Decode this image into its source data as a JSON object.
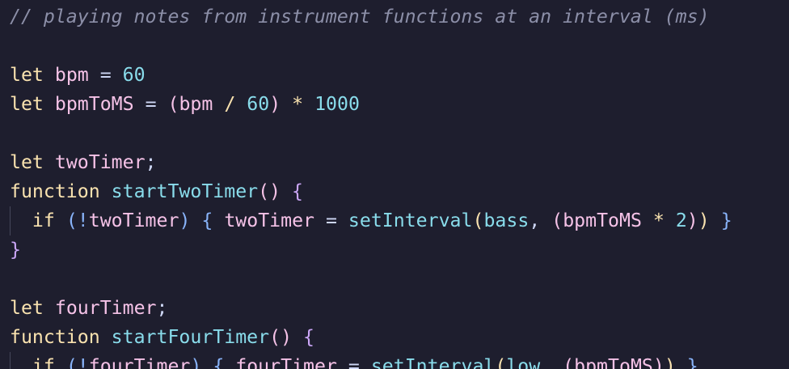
{
  "colors": {
    "background": "#1e1e2e",
    "comment": "#8c8fa8",
    "keyword": "#cba6f7",
    "let": "#f9e2af",
    "variable": "#f5c2e7",
    "plain": "#cdd6f4",
    "number": "#89dceb",
    "operator": "#89dceb",
    "function": "#89dceb",
    "paren_pink": "#f5c2e7",
    "paren_yellow": "#f9e2af",
    "paren_blue": "#89b4fa",
    "brace_pink": "#f5c2e7",
    "brace_blue": "#89b4fa",
    "brace_purple": "#cba6f7",
    "punct": "#cdd6f4",
    "indent_guide": "#45475a"
  },
  "lines": [
    {
      "indent": false,
      "tokens": [
        {
          "t": "// playing notes from instrument functions at an interval (ms)",
          "c": "comment",
          "i": true
        }
      ]
    },
    {
      "indent": false,
      "tokens": []
    },
    {
      "indent": false,
      "tokens": [
        {
          "t": "let",
          "c": "let"
        },
        {
          "t": " ",
          "c": "plain"
        },
        {
          "t": "bpm",
          "c": "variable"
        },
        {
          "t": " ",
          "c": "plain"
        },
        {
          "t": "=",
          "c": "plain"
        },
        {
          "t": " ",
          "c": "plain"
        },
        {
          "t": "60",
          "c": "number"
        }
      ]
    },
    {
      "indent": false,
      "tokens": [
        {
          "t": "let",
          "c": "let"
        },
        {
          "t": " ",
          "c": "plain"
        },
        {
          "t": "bpmToMS",
          "c": "variable"
        },
        {
          "t": " ",
          "c": "plain"
        },
        {
          "t": "=",
          "c": "plain"
        },
        {
          "t": " ",
          "c": "plain"
        },
        {
          "t": "(",
          "c": "paren_pink"
        },
        {
          "t": "bpm",
          "c": "variable"
        },
        {
          "t": " ",
          "c": "plain"
        },
        {
          "t": "/",
          "c": "let"
        },
        {
          "t": " ",
          "c": "plain"
        },
        {
          "t": "60",
          "c": "number"
        },
        {
          "t": ")",
          "c": "paren_pink"
        },
        {
          "t": " ",
          "c": "plain"
        },
        {
          "t": "*",
          "c": "let"
        },
        {
          "t": " ",
          "c": "plain"
        },
        {
          "t": "1000",
          "c": "number"
        }
      ]
    },
    {
      "indent": false,
      "tokens": []
    },
    {
      "indent": false,
      "tokens": [
        {
          "t": "let",
          "c": "let"
        },
        {
          "t": " ",
          "c": "plain"
        },
        {
          "t": "twoTimer",
          "c": "variable"
        },
        {
          "t": ";",
          "c": "punct"
        }
      ]
    },
    {
      "indent": false,
      "tokens": [
        {
          "t": "function",
          "c": "let"
        },
        {
          "t": " ",
          "c": "plain"
        },
        {
          "t": "startTwoTimer",
          "c": "function"
        },
        {
          "t": "()",
          "c": "paren_pink"
        },
        {
          "t": " ",
          "c": "plain"
        },
        {
          "t": "{",
          "c": "brace_purple"
        }
      ]
    },
    {
      "indent": true,
      "tokens": [
        {
          "t": "  ",
          "c": "plain"
        },
        {
          "t": "if",
          "c": "let"
        },
        {
          "t": " ",
          "c": "plain"
        },
        {
          "t": "(",
          "c": "brace_blue"
        },
        {
          "t": "!",
          "c": "paren_blue"
        },
        {
          "t": "twoTimer",
          "c": "variable"
        },
        {
          "t": ")",
          "c": "brace_blue"
        },
        {
          "t": " ",
          "c": "plain"
        },
        {
          "t": "{",
          "c": "brace_blue"
        },
        {
          "t": " ",
          "c": "plain"
        },
        {
          "t": "twoTimer",
          "c": "variable"
        },
        {
          "t": " ",
          "c": "plain"
        },
        {
          "t": "=",
          "c": "plain"
        },
        {
          "t": " ",
          "c": "plain"
        },
        {
          "t": "setInterval",
          "c": "function"
        },
        {
          "t": "(",
          "c": "paren_yellow"
        },
        {
          "t": "bass",
          "c": "function"
        },
        {
          "t": ",",
          "c": "punct"
        },
        {
          "t": " ",
          "c": "plain"
        },
        {
          "t": "(",
          "c": "paren_pink"
        },
        {
          "t": "bpmToMS",
          "c": "variable"
        },
        {
          "t": " ",
          "c": "plain"
        },
        {
          "t": "*",
          "c": "let"
        },
        {
          "t": " ",
          "c": "plain"
        },
        {
          "t": "2",
          "c": "number"
        },
        {
          "t": ")",
          "c": "paren_pink"
        },
        {
          "t": ")",
          "c": "paren_yellow"
        },
        {
          "t": " ",
          "c": "plain"
        },
        {
          "t": "}",
          "c": "brace_blue"
        }
      ]
    },
    {
      "indent": false,
      "tokens": [
        {
          "t": "}",
          "c": "brace_purple"
        }
      ]
    },
    {
      "indent": false,
      "tokens": []
    },
    {
      "indent": false,
      "tokens": [
        {
          "t": "let",
          "c": "let"
        },
        {
          "t": " ",
          "c": "plain"
        },
        {
          "t": "fourTimer",
          "c": "variable"
        },
        {
          "t": ";",
          "c": "punct"
        }
      ]
    },
    {
      "indent": false,
      "tokens": [
        {
          "t": "function",
          "c": "let"
        },
        {
          "t": " ",
          "c": "plain"
        },
        {
          "t": "startFourTimer",
          "c": "function"
        },
        {
          "t": "()",
          "c": "paren_pink"
        },
        {
          "t": " ",
          "c": "plain"
        },
        {
          "t": "{",
          "c": "brace_purple"
        }
      ]
    },
    {
      "indent": true,
      "tokens": [
        {
          "t": "  ",
          "c": "plain"
        },
        {
          "t": "if",
          "c": "let"
        },
        {
          "t": " ",
          "c": "plain"
        },
        {
          "t": "(",
          "c": "brace_blue"
        },
        {
          "t": "!",
          "c": "paren_blue"
        },
        {
          "t": "fourTimer",
          "c": "variable"
        },
        {
          "t": ")",
          "c": "brace_blue"
        },
        {
          "t": " ",
          "c": "plain"
        },
        {
          "t": "{",
          "c": "brace_blue"
        },
        {
          "t": " ",
          "c": "plain"
        },
        {
          "t": "fourTimer",
          "c": "variable"
        },
        {
          "t": " ",
          "c": "plain"
        },
        {
          "t": "=",
          "c": "plain"
        },
        {
          "t": " ",
          "c": "plain"
        },
        {
          "t": "setInterval",
          "c": "function"
        },
        {
          "t": "(",
          "c": "paren_yellow"
        },
        {
          "t": "low",
          "c": "function"
        },
        {
          "t": ",",
          "c": "punct"
        },
        {
          "t": " ",
          "c": "plain"
        },
        {
          "t": "(",
          "c": "paren_pink"
        },
        {
          "t": "bpmToMS",
          "c": "variable"
        },
        {
          "t": ")",
          "c": "paren_pink"
        },
        {
          "t": ")",
          "c": "paren_yellow"
        },
        {
          "t": " ",
          "c": "plain"
        },
        {
          "t": "}",
          "c": "brace_blue"
        }
      ]
    }
  ]
}
